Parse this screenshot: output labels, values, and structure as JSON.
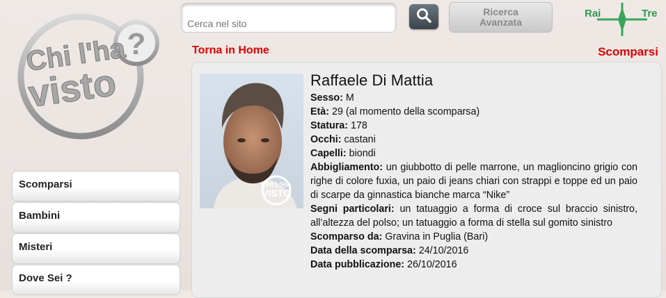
{
  "logo": {
    "line1": "Chi l'ha",
    "line2": "visto"
  },
  "search": {
    "placeholder": "Cerca nel sito"
  },
  "advanced_search": {
    "line1": "Ricerca",
    "line2": "Avanzata"
  },
  "channel_logo": {
    "left": "Rai",
    "right": "Tre"
  },
  "nav": {
    "home_link": "Torna in Home",
    "section_title": "Scomparsi"
  },
  "sidebar": {
    "items": [
      {
        "label": "Scomparsi"
      },
      {
        "label": "Bambini"
      },
      {
        "label": "Misteri"
      },
      {
        "label": "Dove Sei ?"
      }
    ]
  },
  "person": {
    "name": "Raffaele Di Mattia",
    "photo_watermark": {
      "line1": "CHI L'HA",
      "line2": "VISTO"
    },
    "fields": [
      {
        "label": "Sesso:",
        "value": "M"
      },
      {
        "label": "Età:",
        "value": "29 (al momento della scomparsa)"
      },
      {
        "label": "Statura:",
        "value": "178"
      },
      {
        "label": "Occhi:",
        "value": "castani"
      },
      {
        "label": "Capelli:",
        "value": "biondi"
      },
      {
        "label": "Abbigliamento:",
        "value": "un giubbotto di pelle marrone, un maglioncino grigio con righe di colore fuxia, un paio di jeans chiari con strappi e toppe ed un paio di scarpe da ginnastica bianche marca “Nike”"
      },
      {
        "label": "Segni particolari:",
        "value": "un tatuaggio a forma di croce sul braccio sinistro, all’altezza del polso; un tatuaggio a forma di stella sul gomito sinistro"
      },
      {
        "label": "Scomparso da:",
        "value": "Gravina in Puglia (Bari)"
      },
      {
        "label": "Data della scomparsa:",
        "value": "24/10/2016"
      },
      {
        "label": "Data pubblicazione:",
        "value": "26/10/2016"
      }
    ]
  },
  "colors": {
    "accent_red": "#e00000",
    "card_bg": "#ededed"
  }
}
